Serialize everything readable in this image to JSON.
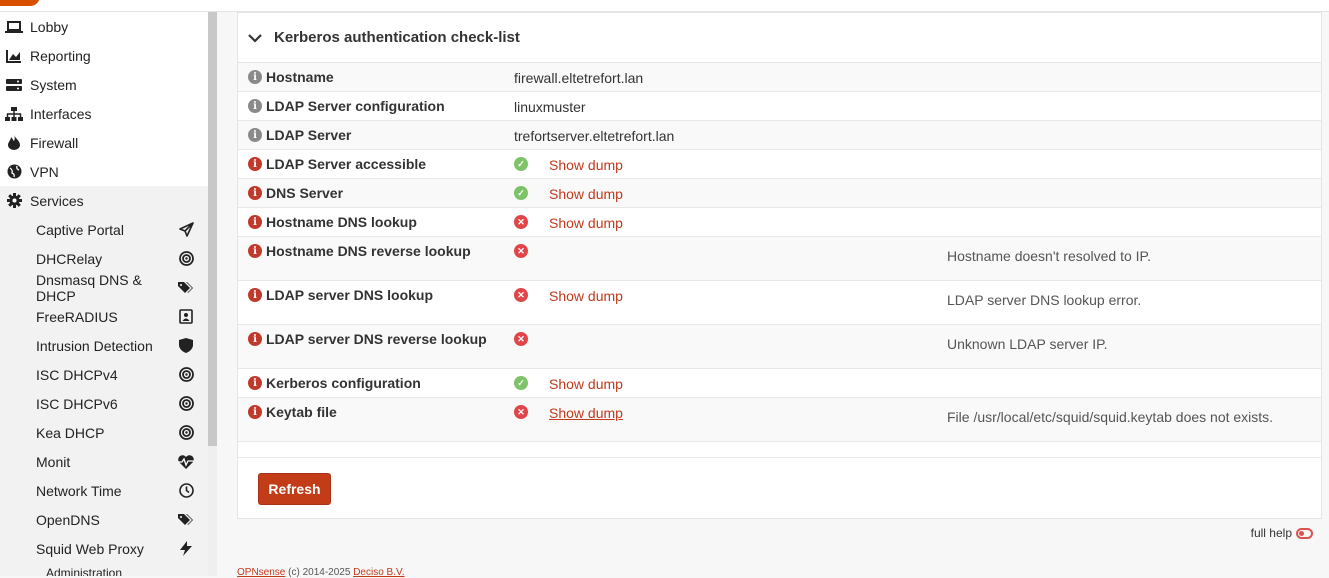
{
  "sidebar": {
    "items": [
      {
        "label": "Lobby",
        "icon": "laptop-icon"
      },
      {
        "label": "Reporting",
        "icon": "chart-icon"
      },
      {
        "label": "System",
        "icon": "server-icon"
      },
      {
        "label": "Interfaces",
        "icon": "sitemap-icon"
      },
      {
        "label": "Firewall",
        "icon": "fire-icon"
      },
      {
        "label": "VPN",
        "icon": "globe-icon"
      },
      {
        "label": "Services",
        "icon": "gear-icon"
      }
    ],
    "services": [
      {
        "label": "Captive Portal",
        "icon": "paper-plane-icon"
      },
      {
        "label": "DHCRelay",
        "icon": "bullseye-icon"
      },
      {
        "label": "Dnsmasq DNS & DHCP",
        "icon": "tags-icon"
      },
      {
        "label": "FreeRADIUS",
        "icon": "address-card-icon"
      },
      {
        "label": "Intrusion Detection",
        "icon": "shield-icon"
      },
      {
        "label": "ISC DHCPv4",
        "icon": "bullseye-icon"
      },
      {
        "label": "ISC DHCPv6",
        "icon": "bullseye-icon"
      },
      {
        "label": "Kea DHCP",
        "icon": "bullseye-icon"
      },
      {
        "label": "Monit",
        "icon": "heartbeat-icon"
      },
      {
        "label": "Network Time",
        "icon": "clock-icon"
      },
      {
        "label": "OpenDNS",
        "icon": "tags-icon"
      },
      {
        "label": "Squid Web Proxy",
        "icon": "bolt-icon"
      },
      {
        "label": "Administration",
        "icon": ""
      }
    ]
  },
  "panel": {
    "title": "Kerberos authentication check-list",
    "rows": [
      {
        "label": "Hostname",
        "value": "firewall.eltetrefort.lan"
      },
      {
        "label": "LDAP Server configuration",
        "value": "linuxmuster"
      },
      {
        "label": "LDAP Server",
        "value": "trefortserver.eltetrefort.lan"
      },
      {
        "label": "LDAP Server accessible",
        "status": "ok",
        "dump": "Show dump"
      },
      {
        "label": "DNS Server",
        "status": "ok",
        "dump": "Show dump"
      },
      {
        "label": "Hostname DNS lookup",
        "status": "fail",
        "dump": "Show dump"
      },
      {
        "label": "Hostname DNS reverse lookup",
        "status": "fail",
        "msg": "Hostname doesn't resolved to IP."
      },
      {
        "label": "LDAP server DNS lookup",
        "status": "fail",
        "dump": "Show dump",
        "msg": "LDAP server DNS lookup error."
      },
      {
        "label": "LDAP server DNS reverse lookup",
        "status": "fail",
        "msg": "Unknown LDAP server IP."
      },
      {
        "label": "Kerberos configuration",
        "status": "ok",
        "dump": "Show dump"
      },
      {
        "label": "Keytab file",
        "status": "fail",
        "dump": "Show dump",
        "msg": "File /usr/local/etc/squid/squid.keytab does not exists."
      }
    ]
  },
  "refresh_label": "Refresh",
  "full_help_label": "full help",
  "footer": {
    "brand": "OPNsense",
    "text": " (c) 2014-2025 ",
    "company": "Deciso B.V."
  },
  "colors": {
    "accent": "#c33c18",
    "ok": "#7cc36a",
    "fail": "#e0454a"
  }
}
